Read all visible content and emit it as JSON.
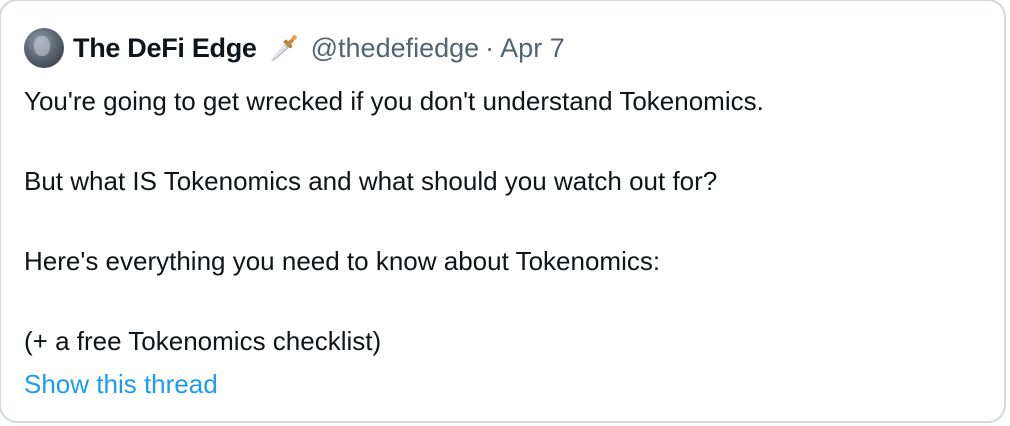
{
  "tweet": {
    "author": {
      "display_name": "The DeFi Edge",
      "handle": "@thedefiedge",
      "badge_icon": "dagger-icon"
    },
    "separator": "·",
    "date": "Apr 7",
    "lines": [
      "You're going to get wrecked if you don't understand Tokenomics.",
      "But what IS Tokenomics and what should you watch out for?",
      "Here's everything you need to know about Tokenomics:",
      "(+ a free Tokenomics checklist)"
    ],
    "show_thread_label": "Show this thread"
  },
  "colors": {
    "text_primary": "#0f1419",
    "text_secondary": "#536471",
    "link": "#1d9bf0",
    "border": "#cfd9de"
  }
}
